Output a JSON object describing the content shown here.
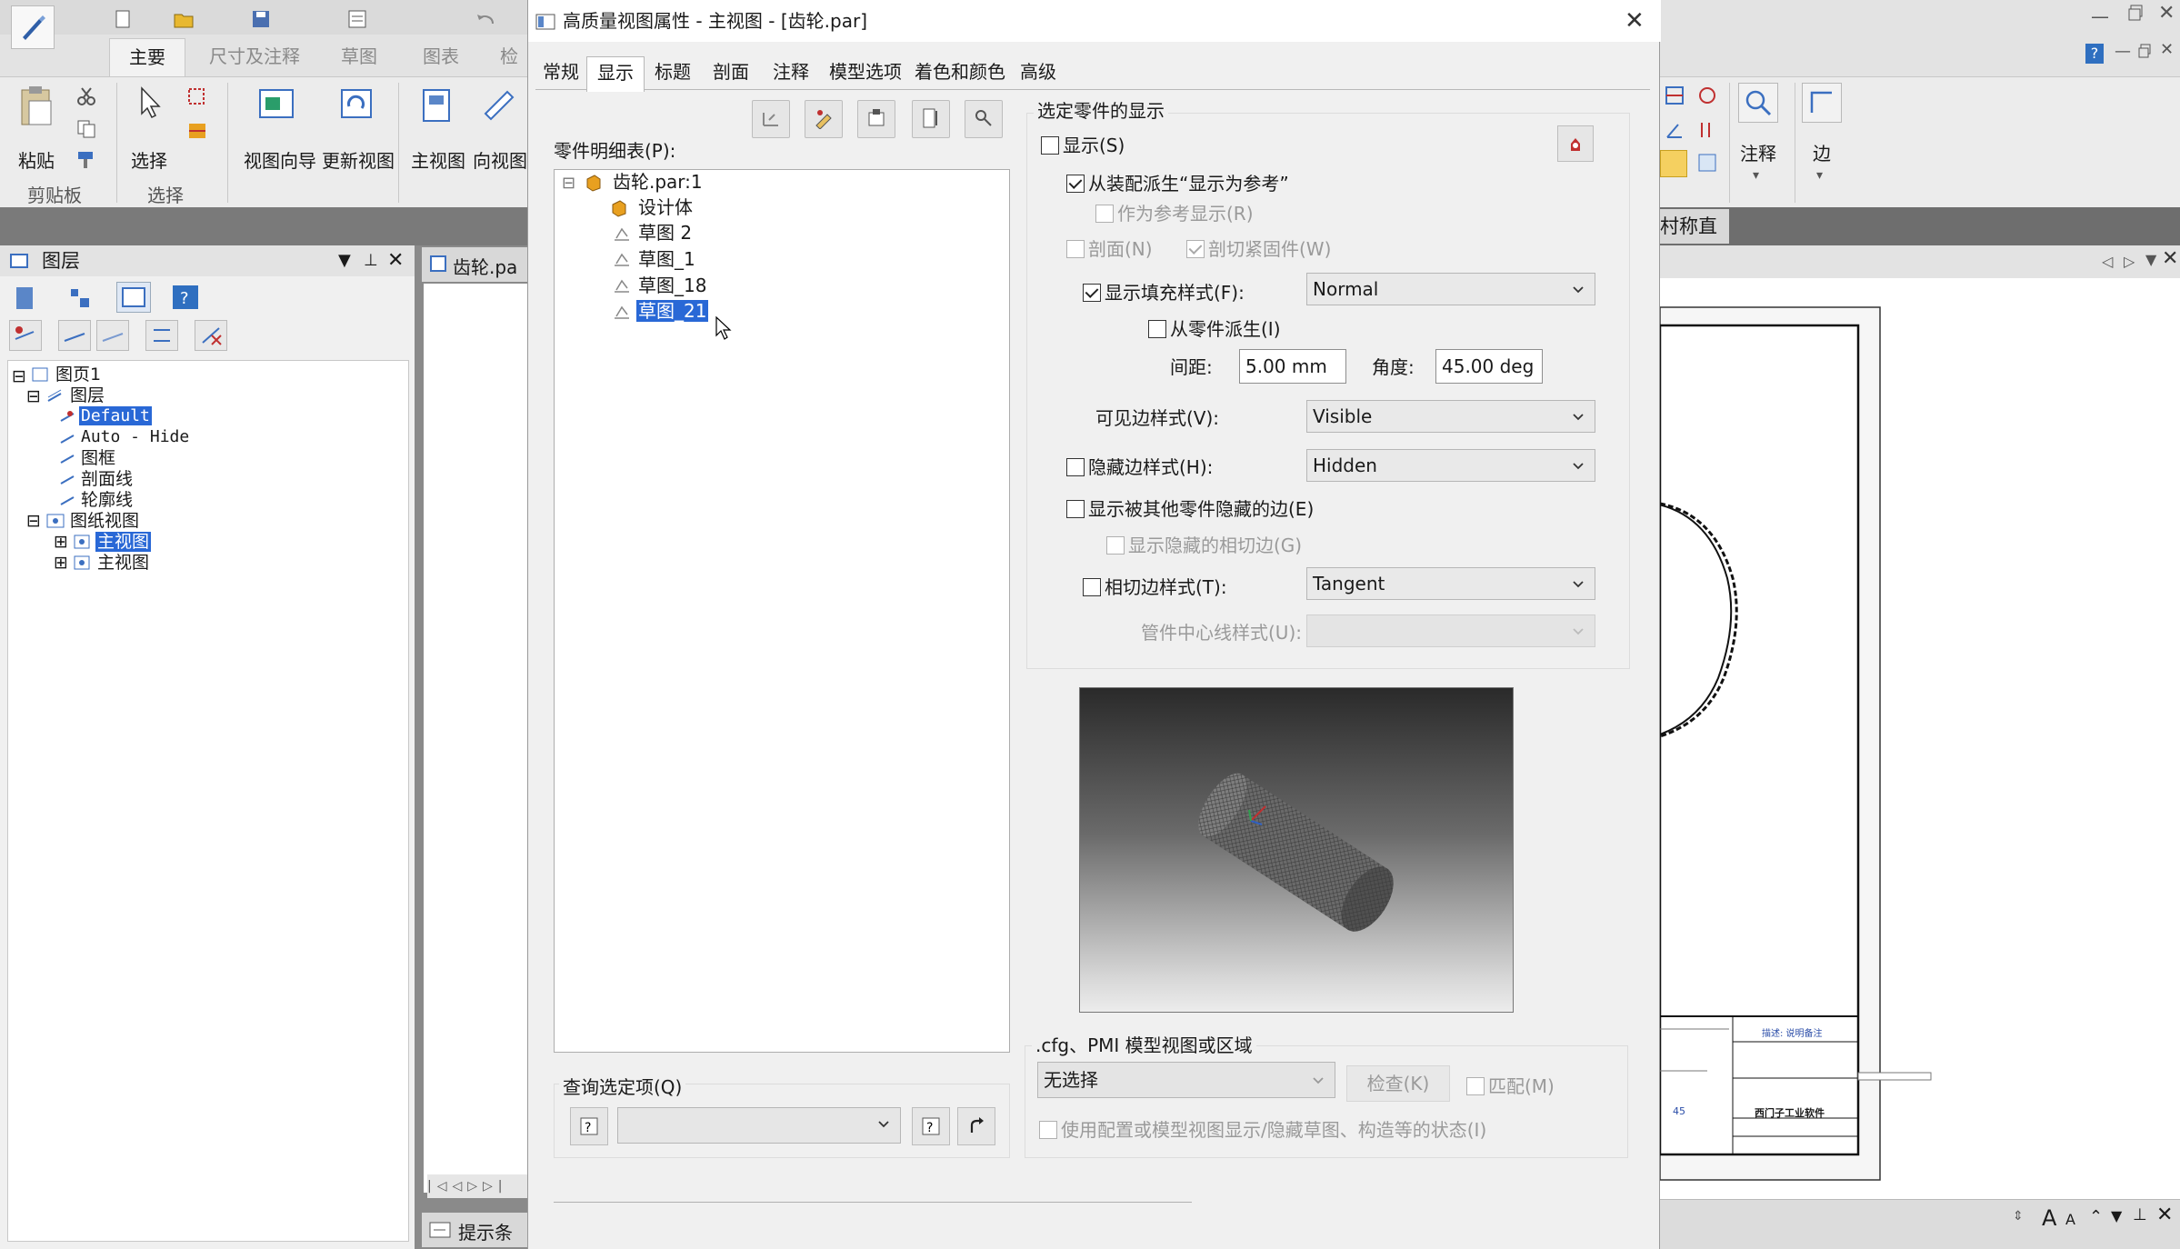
{
  "app": {
    "ribbon_tabs": [
      "主要",
      "尺寸及注释",
      "草图",
      "图表",
      "检"
    ],
    "ribbon_buttons": {
      "paste": "粘贴",
      "select": "选择",
      "view_wizard": "视图向导",
      "update_view": "更新视图",
      "main_view": "主视图",
      "aux_view": "向视图"
    },
    "ribbon_groups": {
      "clipboard": "剪贴板",
      "select": "选择"
    },
    "right_ribbon": {
      "annotate": "注释",
      "edge": "边"
    },
    "right_tab": "村称直径",
    "doc_tab": "齿轮.pa",
    "status_tab": "提示条",
    "title_block": {
      "row1": "描述: 说明备注",
      "company": "西门子工业软件",
      "num": "45"
    }
  },
  "layers_panel": {
    "title": "图层",
    "tree": {
      "sheet": "图页1",
      "layers_group": "图层",
      "layers": [
        "Default",
        "Auto - Hide",
        "图框",
        "剖面线",
        "轮廓线"
      ],
      "views_group": "图纸视图",
      "views": [
        "主视图",
        "主视图"
      ]
    }
  },
  "dialog": {
    "title": "高质量视图属性 - 主视图 - [齿轮.par]",
    "tabs": [
      "常规",
      "显示",
      "标题",
      "剖面",
      "注释",
      "模型选项",
      "着色和颜色",
      "高级"
    ],
    "active_tab": "显示",
    "parts_list_label": "零件明细表(P):",
    "parts_tree": {
      "root": "齿轮.par:1",
      "items": [
        "设计体",
        "草图 2",
        "草图_1",
        "草图_18",
        "草图_21"
      ],
      "selected": "草图_21"
    },
    "query_group": {
      "title": "查询选定项(Q)",
      "value": ""
    },
    "display_group": {
      "title": "选定零件的显示",
      "show": {
        "label": "显示(S)",
        "checked": false
      },
      "derive_ref": {
        "label": "从装配派生“显示为参考”",
        "checked": true
      },
      "show_as_ref": {
        "label": "作为参考显示(R)",
        "checked": false,
        "disabled": true
      },
      "section": {
        "label": "剖面(N)",
        "checked": false,
        "disabled": true
      },
      "cut_fasteners": {
        "label": "剖切紧固件(W)",
        "checked": true,
        "disabled": true
      },
      "fill_style": {
        "label": "显示填充样式(F):",
        "checked": true,
        "value": "Normal"
      },
      "derive_from_part": {
        "label": "从零件派生(I)",
        "checked": false
      },
      "spacing": {
        "label": "间距:",
        "value": "5.00 mm"
      },
      "angle": {
        "label": "角度:",
        "value": "45.00 deg"
      },
      "visible_edge": {
        "label": "可见边样式(V):",
        "value": "Visible"
      },
      "hidden_edge": {
        "label": "隐藏边样式(H):",
        "checked": false,
        "value": "Hidden"
      },
      "show_hidden_by_others": {
        "label": "显示被其他零件隐藏的边(E)",
        "checked": false
      },
      "show_hidden_tangent": {
        "label": "显示隐藏的相切边(G)",
        "checked": false,
        "disabled": true
      },
      "tangent_edge": {
        "label": "相切边样式(T):",
        "checked": false,
        "value": "Tangent"
      },
      "tube_centerline": {
        "label": "管件中心线样式(U):",
        "value": "",
        "disabled": true
      }
    },
    "cfg_group": {
      "title": ".cfg、PMI 模型视图或区域",
      "select_value": "无选择",
      "check_button": "检查(K)",
      "match": {
        "label": "匹配(M)",
        "checked": false
      },
      "use_config": {
        "label": "使用配置或模型视图显示/隐藏草图、构造等的状态(I)",
        "checked": false
      }
    }
  },
  "colors": {
    "selection": "#2968d6",
    "dialog_bg": "#f0f0f0"
  }
}
